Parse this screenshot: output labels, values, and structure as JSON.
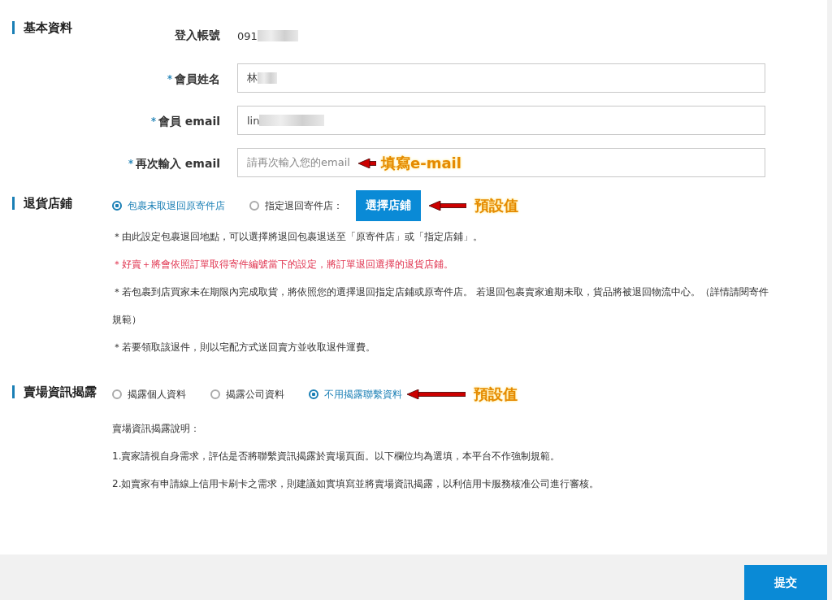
{
  "sections": [
    {
      "kind": "fields",
      "title": "基本資料",
      "fields": [
        {
          "kind": "static",
          "label": "登入帳號",
          "required": false,
          "value": "091",
          "redacted": true
        },
        {
          "kind": "input",
          "label": "會員姓名",
          "required": true,
          "value": "林",
          "redacted": true
        },
        {
          "kind": "input",
          "label": "會員 email",
          "required": true,
          "value": "lin",
          "redacted": true
        },
        {
          "kind": "input",
          "label": "再次輸入 email",
          "required": true,
          "placeholder": "請再次輸入您的email",
          "annotation": "填寫e-mail"
        }
      ]
    },
    {
      "kind": "return_store",
      "title": "退貨店鋪",
      "options": [
        {
          "label": "包裹未取退回原寄件店",
          "selected": true
        },
        {
          "label": "指定退回寄件店：",
          "selected": false
        }
      ],
      "store_button": "選擇店鋪",
      "annotation": "預設值",
      "notes": [
        {
          "kind": "normal",
          "text": "＊由此設定包裹退回地點，可以選擇將退回包裹退送至「原寄件店」或「指定店鋪」。"
        },
        {
          "kind": "warning",
          "text": "＊好賣＋將會依照訂單取得寄件編號當下的設定，將訂單退回選擇的退貨店鋪。"
        },
        {
          "kind": "normal",
          "text": "＊若包裹到店買家未在期限內完成取貨，將依照您的選擇退回指定店鋪或原寄件店。 若退回包裹賣家逾期未取，貨品將被退回物流中心。（詳情請閱寄件規範）"
        },
        {
          "kind": "normal",
          "text": "＊若要領取該退件，則以宅配方式送回賣方並收取退件運費。"
        }
      ]
    },
    {
      "kind": "disclosure",
      "title": "賣場資訊揭露",
      "options": [
        {
          "label": "揭露個人資料",
          "selected": false
        },
        {
          "label": "揭露公司資料",
          "selected": false
        },
        {
          "label": "不用揭露聯繫資料",
          "selected": true
        }
      ],
      "annotation": "預設值",
      "notes": [
        {
          "kind": "normal",
          "text": "賣場資訊揭露說明："
        },
        {
          "kind": "normal",
          "text": "1.賣家請視自身需求，評估是否將聯繫資訊揭露於賣場頁面。以下欄位均為選填，本平台不作強制規範。"
        },
        {
          "kind": "normal",
          "text": "2.如賣家有申請線上信用卡刷卡之需求，則建議如實填寫並將賣場資訊揭露，以利信用卡服務核准公司進行審核。"
        }
      ]
    }
  ],
  "submit_button": "提交"
}
